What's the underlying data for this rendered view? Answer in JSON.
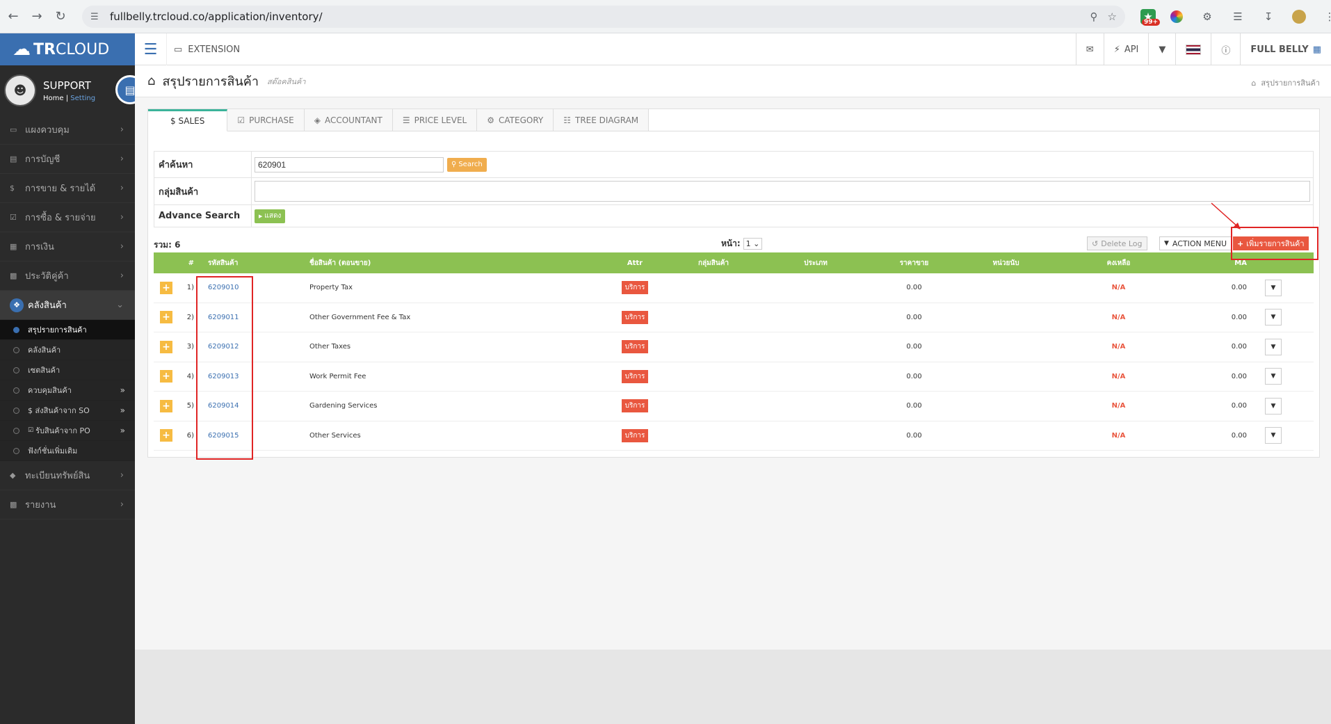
{
  "browser": {
    "url": "fullbelly.trcloud.co/application/inventory/",
    "badge": "99+"
  },
  "header": {
    "logo_main": "TR",
    "logo_light": "CLOUD",
    "extension_label": "EXTENSION",
    "api_label": "API",
    "company_label": "FULL BELLY"
  },
  "profile": {
    "name": "SUPPORT",
    "home_link": "Home",
    "separator": "|",
    "setting_link": "Setting"
  },
  "sidebar": {
    "items": [
      {
        "label": "แผงควบคุม",
        "icon": "monitor-icon"
      },
      {
        "label": "การบัญชี",
        "icon": "book-icon"
      },
      {
        "label": "การขาย & รายได้",
        "icon": "dollar-icon"
      },
      {
        "label": "การซื้อ & รายจ่าย",
        "icon": "cart-icon"
      },
      {
        "label": "การเงิน",
        "icon": "calendar-icon"
      },
      {
        "label": "ประวัติคู่ค้า",
        "icon": "contact-icon"
      }
    ],
    "active_item": {
      "label": "คลังสินค้า",
      "icon": "cubes-icon"
    },
    "sub_items": [
      {
        "label": "สรุปรายการสินค้า",
        "active": true
      },
      {
        "label": "คลังสินค้า"
      },
      {
        "label": "เซตสินค้า"
      },
      {
        "label": "ควบคุมสินค้า",
        "chevron": "»"
      },
      {
        "label": "$ ส่งสินค้าจาก SO",
        "chevron": "»"
      },
      {
        "label": "รับสินค้าจาก PO",
        "chevron": "»"
      },
      {
        "label": "ฟังก์ชั่นเพิ่มเติม"
      }
    ],
    "bottom_items": [
      {
        "label": "ทะเบียนทรัพย์สิน",
        "icon": "diamond-icon"
      },
      {
        "label": "รายงาน",
        "icon": "report-icon"
      }
    ]
  },
  "page": {
    "title": "สรุปรายการสินค้า",
    "subtitle": "สต๊อคสินค้า",
    "breadcrumb": "สรุปรายการสินค้า"
  },
  "tabs": [
    {
      "label": "$ SALES",
      "active": true
    },
    {
      "label": "PURCHASE",
      "icon": "cart-icon"
    },
    {
      "label": "ACCOUNTANT",
      "icon": "graduation-cap-icon"
    },
    {
      "label": "PRICE LEVEL",
      "icon": "list-icon"
    },
    {
      "label": "CATEGORY",
      "icon": "gear-icon"
    },
    {
      "label": "TREE DIAGRAM",
      "icon": "sitemap-icon"
    }
  ],
  "search": {
    "keyword_label": "คำค้นหา",
    "keyword_value": "620901",
    "search_button": "Search",
    "group_label": "กลุ่มสินค้า",
    "group_value": "",
    "advance_label": "Advance Search",
    "show_button": "แสดง"
  },
  "toolbar": {
    "total_label": "รวม: 6",
    "page_label": "หน้า:",
    "page_value": "1",
    "delete_log": "Delete Log",
    "action_menu": "ACTION MENU",
    "add_product": "เพิ่มรายการสินค้า"
  },
  "table": {
    "headers": [
      "#",
      "รหัสสินค้า",
      "ชื่อสินค้า (ตอนขาย)",
      "Attr",
      "กลุ่มสินค้า",
      "ประเภท",
      "ราคาขาย",
      "หน่วยนับ",
      "คงเหลือ",
      "MA"
    ],
    "rows": [
      {
        "num": "1)",
        "code": "6209010",
        "name": "Property Tax",
        "attr": "บริการ",
        "group": "",
        "type": "",
        "price": "0.00",
        "unit": "",
        "stock": "N/A",
        "ma": "0.00"
      },
      {
        "num": "2)",
        "code": "6209011",
        "name": "Other Government Fee & Tax",
        "attr": "บริการ",
        "group": "",
        "type": "",
        "price": "0.00",
        "unit": "",
        "stock": "N/A",
        "ma": "0.00"
      },
      {
        "num": "3)",
        "code": "6209012",
        "name": "Other Taxes",
        "attr": "บริการ",
        "group": "",
        "type": "",
        "price": "0.00",
        "unit": "",
        "stock": "N/A",
        "ma": "0.00"
      },
      {
        "num": "4)",
        "code": "6209013",
        "name": "Work Permit Fee",
        "attr": "บริการ",
        "group": "",
        "type": "",
        "price": "0.00",
        "unit": "",
        "stock": "N/A",
        "ma": "0.00"
      },
      {
        "num": "5)",
        "code": "6209014",
        "name": "Gardening Services",
        "attr": "บริการ",
        "group": "",
        "type": "",
        "price": "0.00",
        "unit": "",
        "stock": "N/A",
        "ma": "0.00"
      },
      {
        "num": "6)",
        "code": "6209015",
        "name": "Other Services",
        "attr": "บริการ",
        "group": "",
        "type": "",
        "price": "0.00",
        "unit": "",
        "stock": "N/A",
        "ma": "0.00"
      }
    ]
  },
  "colors": {
    "brand_blue": "#3a6fb0",
    "table_header_green": "#8cc152",
    "add_red": "#e9573f",
    "annotation_red": "#e02424"
  }
}
